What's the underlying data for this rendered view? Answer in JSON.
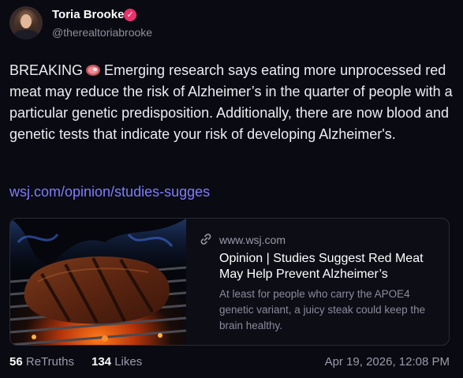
{
  "author": {
    "display_name": "Toria Brooke",
    "handle": "@therealtoriabrooke",
    "verified_icon": "verified-check-icon",
    "verified_color": "#e8326a"
  },
  "post": {
    "prefix": "BREAKING",
    "emoji": "steak-emoji",
    "text": "Emerging research says eating more unprocessed red meat may reduce the risk of Alzheimer’s in the quarter of people with a particular genetic predisposition. Additionally, there are now blood and genetic tests that indicate your risk of developing Alzheimer's.",
    "link_text": "wsj.com/opinion/studies-sugges"
  },
  "card": {
    "domain": "www.wsj.com",
    "domain_icon": "link-icon",
    "title": "Opinion | Studies Suggest Red Meat May Help Prevent Alzheimer’s",
    "description": "At least for people who carry the APOE4 genetic variant, a juicy steak could keep the brain healthy.",
    "image": "grilled-steak-image"
  },
  "stats": {
    "retruths_count": "56",
    "retruths_label": "ReTruths",
    "likes_count": "134",
    "likes_label": "Likes"
  },
  "timestamp": "Apr 19, 2026, 12:08 PM",
  "colors": {
    "background": "#0a0a12",
    "link": "#7f7cff",
    "muted": "#9a9aac"
  }
}
